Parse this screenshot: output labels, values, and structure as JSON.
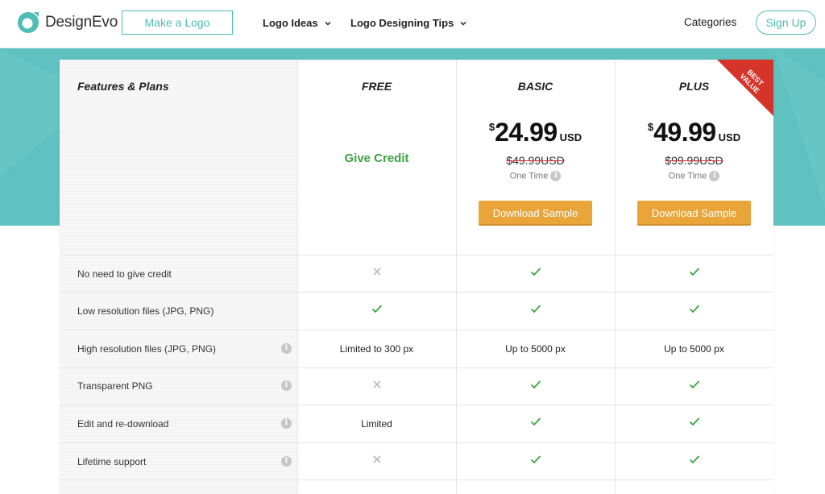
{
  "header": {
    "brand": "DesignEvo",
    "make_logo": "Make a Logo",
    "nav": [
      "Logo Ideas",
      "Logo Designing Tips"
    ],
    "categories": "Categories",
    "signup": "Sign Up"
  },
  "plans": {
    "features_title": "Features & Plans",
    "free": {
      "name": "FREE",
      "credit": "Give Credit"
    },
    "basic": {
      "name": "BASIC",
      "currency": "$",
      "price": "24.99",
      "unit": "USD",
      "old_price": "$49.99USD",
      "term": "One Time",
      "button": "Download Sample"
    },
    "plus": {
      "name": "PLUS",
      "currency": "$",
      "price": "49.99",
      "unit": "USD",
      "old_price": "$99.99USD",
      "term": "One Time",
      "button": "Download Sample",
      "ribbon": "BEST VALUE"
    }
  },
  "features": [
    {
      "label": "No need to give credit",
      "info": false,
      "free": "cross",
      "basic": "check",
      "plus": "check"
    },
    {
      "label": "Low resolution files (JPG, PNG)",
      "info": false,
      "free": "check",
      "basic": "check",
      "plus": "check"
    },
    {
      "label": "High resolution files (JPG, PNG)",
      "info": true,
      "free": "Limited to 300 px",
      "basic": "Up to 5000 px",
      "plus": "Up to 5000 px"
    },
    {
      "label": "Transparent PNG",
      "info": true,
      "free": "cross",
      "basic": "check",
      "plus": "check"
    },
    {
      "label": "Edit and re-download",
      "info": true,
      "free": "Limited",
      "basic": "check",
      "plus": "check"
    },
    {
      "label": "Lifetime support",
      "info": true,
      "free": "cross",
      "basic": "check",
      "plus": "check"
    }
  ],
  "colors": {
    "accent": "#4fbcb5",
    "band": "#5fc2c0",
    "button": "#e9a43a",
    "check": "#3aa43f",
    "cross": "#b9b9b9",
    "ribbon": "#d4342a"
  }
}
